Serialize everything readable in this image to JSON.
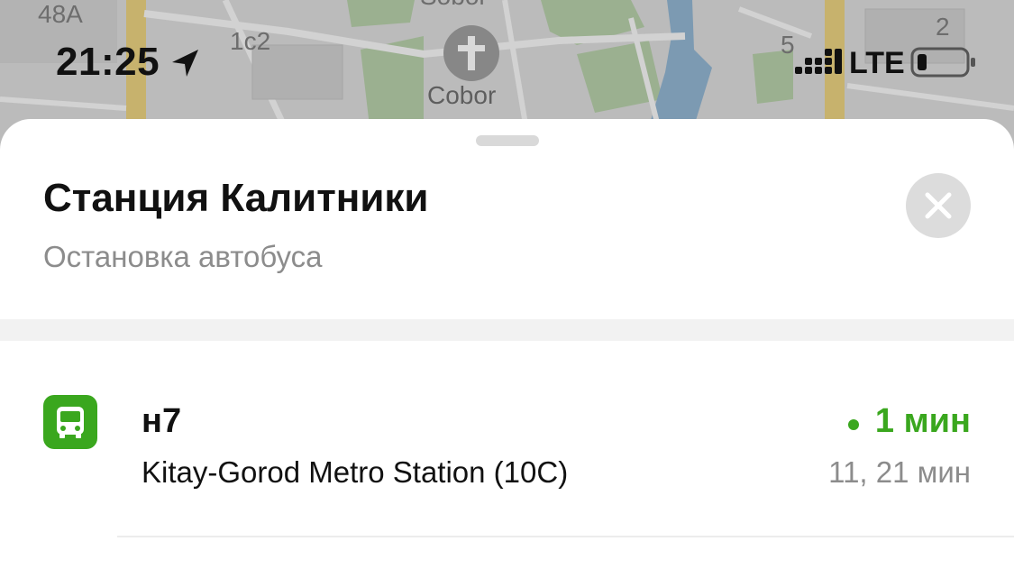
{
  "status_bar": {
    "time": "21:25",
    "network": "LTE",
    "icons": [
      "location-arrow-icon",
      "signal-icon",
      "battery-icon"
    ]
  },
  "map": {
    "labels": {
      "house_48a": "48A",
      "house_1c2": "1c2",
      "house_5": "5",
      "house_2": "2",
      "sobor_top": "Sobor",
      "cobor": "Cobor"
    },
    "icons": [
      "church-cross-icon"
    ]
  },
  "sheet": {
    "title": "Станция Калитники",
    "subtitle": "Остановка автобуса",
    "close_icon": "close-icon"
  },
  "routes": [
    {
      "number": "н7",
      "destination": "Kitay-Gorod Metro Station (10C)",
      "eta": "1 мин",
      "next_arrivals": "11, 21 мин",
      "icon": "bus-icon"
    }
  ],
  "colors": {
    "accent_green": "#3aa71e",
    "muted_text": "#8c8c8c",
    "close_button_bg": "#dcdcdc"
  }
}
